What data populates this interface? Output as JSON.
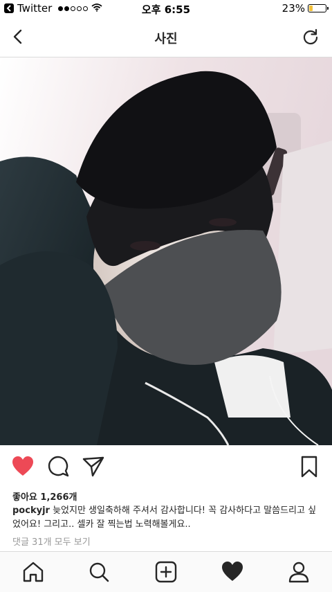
{
  "status_bar": {
    "back_app": "Twitter",
    "time": "오후 6:55",
    "battery": "23%",
    "battery_level": 0.23,
    "signal_bars_filled": 2,
    "signal_bars_total": 5,
    "icons": [
      "back-arrow-icon",
      "wifi-icon",
      "battery-icon"
    ]
  },
  "header": {
    "title": "사진",
    "icons": [
      "chevron-left-icon",
      "refresh-icon"
    ]
  },
  "post": {
    "likes": "좋아요 1,266개",
    "username": "pockyjr",
    "caption": " 늦었지만 생일축하해 주셔서 감사합니다! 꼭 감사하다고 말씀드리고 싶었어요! 그리고.. 셀카 잘 찍는법 노력해볼게요..",
    "view_comments": "댓글 31개 모두 보기",
    "liked": true,
    "like_color": "#ed4956",
    "action_icons": [
      "heart-icon",
      "comment-icon",
      "share-icon",
      "bookmark-icon"
    ]
  },
  "tab_bar": {
    "icons": [
      "home-icon",
      "search-icon",
      "add-post-icon",
      "activity-heart-icon",
      "profile-icon"
    ]
  }
}
